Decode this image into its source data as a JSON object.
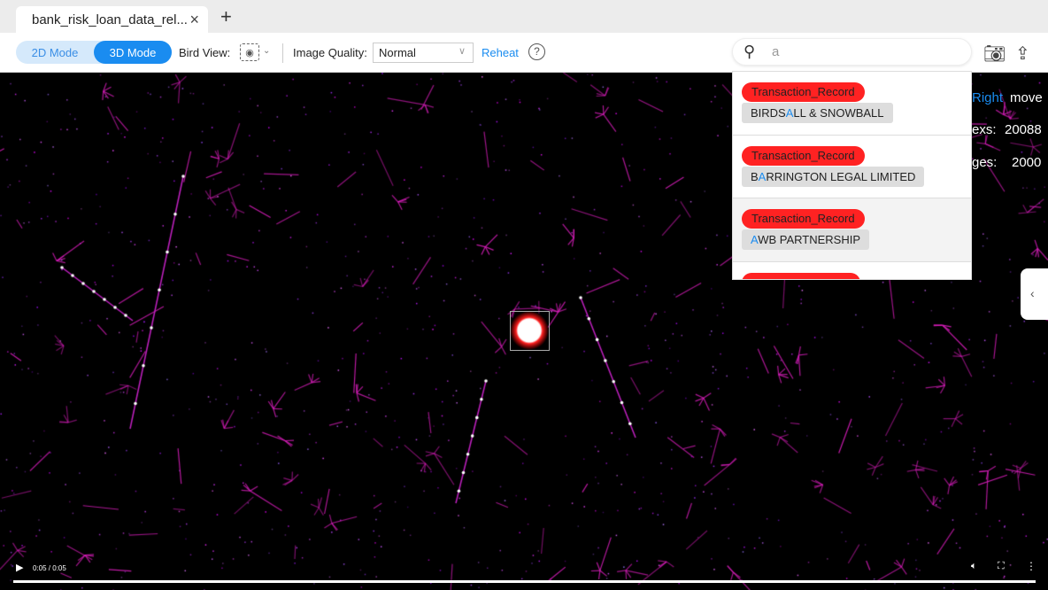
{
  "tab": {
    "title": "bank_risk_loan_data_rel...",
    "close": "×",
    "new_tab": "+"
  },
  "toolbar": {
    "mode_2d": "2D Mode",
    "mode_3d": "3D Mode",
    "active_mode": "3D Mode",
    "bird_view_label": "Bird View:",
    "image_quality_label": "Image Quality:",
    "image_quality_value": "Normal",
    "reheat": "Reheat",
    "help": "?"
  },
  "search": {
    "value": "a",
    "icon": "search-icon"
  },
  "results": [
    {
      "type": "Transaction_Record",
      "pre": "BIRDS",
      "hl": "A",
      "post": "LL & SNOWBALL"
    },
    {
      "type": "Transaction_Record",
      "pre": "B",
      "hl": "A",
      "post": "RRINGTON LEGAL LIMITED"
    },
    {
      "type": "Transaction_Record",
      "pre": "",
      "hl": "A",
      "post": "WB PARTNERSHIP"
    }
  ],
  "overlay": {
    "hint_key": "Right",
    "hint_action": "move",
    "vertexes_label": "exs:",
    "vertexes_value": "20088",
    "edges_label": "ges:",
    "edges_value": "2000"
  },
  "player": {
    "time": "0:05 / 0:05",
    "progress": 1.0
  },
  "colors": {
    "accent": "#1a8cf0",
    "tag": "#ff2222",
    "edge": "#d020b0"
  }
}
